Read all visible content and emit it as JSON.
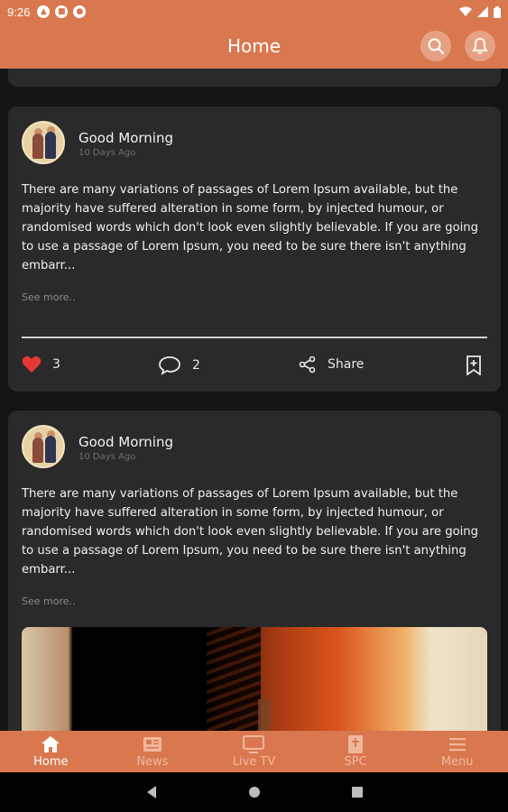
{
  "status_bar": {
    "time": "9:26"
  },
  "app_bar": {
    "title": "Home"
  },
  "posts": [
    {
      "author": "Good Morning",
      "ago": "10 Days Ago",
      "body": "There are many variations of passages of Lorem Ipsum available, but the majority have suffered alteration in some form, by injected humour, or randomised words which don't look even slightly believable. If you are going to use a passage of Lorem Ipsum, you need to be sure there isn't anything embarr...",
      "see_more": "See more..",
      "likes": "3",
      "comments": "2",
      "share": "Share"
    },
    {
      "author": "Good Morning",
      "ago": "10 Days Ago",
      "body": "There are many variations of passages of Lorem Ipsum available, but the majority have suffered alteration in some form, by injected humour, or randomised words which don't look even slightly believable. If you are going to use a passage of Lorem Ipsum, you need to be sure there isn't anything embarr...",
      "see_more": "See more.."
    }
  ],
  "bottom_nav": {
    "items": [
      {
        "label": "Home",
        "icon": "home-icon",
        "active": true
      },
      {
        "label": "News",
        "icon": "news-icon"
      },
      {
        "label": "Live TV",
        "icon": "tv-icon"
      },
      {
        "label": "SPC",
        "icon": "spc-icon"
      },
      {
        "label": "Menu",
        "icon": "menu-icon"
      }
    ]
  },
  "colors": {
    "accent": "#d9784f",
    "card": "#2a2a2a",
    "like": "#e53935"
  }
}
